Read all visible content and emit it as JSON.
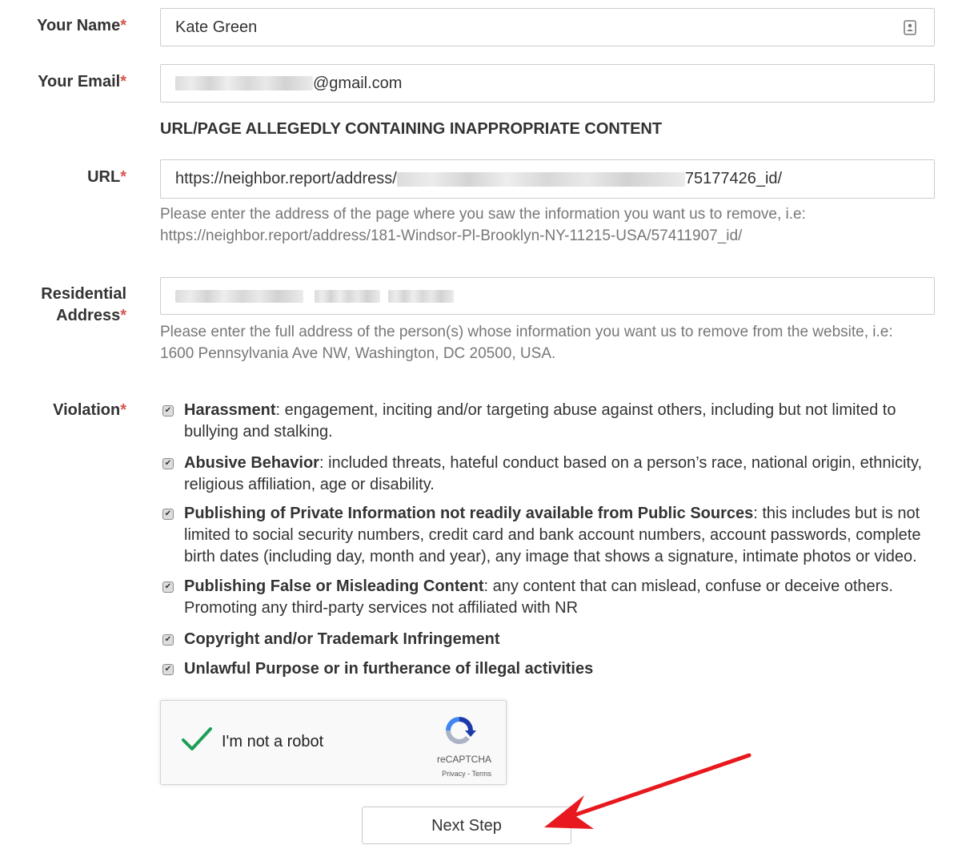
{
  "fields": {
    "name": {
      "label": "Your Name",
      "value": "Kate Green"
    },
    "email": {
      "label": "Your Email",
      "value_visible": "@gmail.com"
    },
    "url": {
      "label": "URL",
      "value_prefix": "https://neighbor.report/address/",
      "value_suffix": "75177426_id/",
      "help_line1": "Please enter the address of the page where you saw the information you want us to remove, i.e:",
      "help_line2": "https://neighbor.report/address/181-Windsor-Pl-Brooklyn-NY-11215-USA/57411907_id/"
    },
    "address": {
      "label_line1": "Residential",
      "label_line2": "Address",
      "help_line1": "Please enter the full address of the person(s) whose information you want us to remove from the website, i.e:",
      "help_line2": "1600 Pennsylvania Ave NW, Washington, DC 20500, USA."
    },
    "required_mark": "*"
  },
  "section_heading": "URL/PAGE ALLEGEDLY CONTAINING INAPPROPRIATE CONTENT",
  "violation": {
    "label": "Violation",
    "items": [
      {
        "title": "Harassment",
        "desc_line1": ": engagement, inciting and/or targeting abuse against others, including but not limited to",
        "desc_line2": "bullying and stalking.",
        "checked": true
      },
      {
        "title": "Abusive Behavior",
        "desc_line1": ": included threats, hateful conduct based on a person’s race, national origin, ethnicity,",
        "desc_line2": "religious affiliation, age or disability.",
        "checked": true
      },
      {
        "title": "Publishing of Private Information not readily available from Public Sources",
        "desc_line1": ": this includes but is not",
        "desc_line2": "limited to social security numbers, credit card and bank account numbers, account passwords, complete",
        "desc_line3": "birth dates (including day, month and year), any image that shows a signature, intimate photos or video.",
        "checked": true
      },
      {
        "title": "Publishing False or Misleading Content",
        "desc_line1": ": any content that can mislead, confuse or deceive others.",
        "desc_line2": "Promoting any third-party services not affiliated with NR",
        "checked": true
      },
      {
        "title": "Copyright and/or Trademark Infringement",
        "checked": true
      },
      {
        "title": "Unlawful Purpose or in furtherance of illegal activities",
        "checked": true
      }
    ]
  },
  "captcha": {
    "label": "I'm not a robot",
    "brand": "reCAPTCHA",
    "terms": "Privacy - Terms",
    "checked": true
  },
  "next_button": "Next Step",
  "icons": {
    "contact_card": "contact-card-icon",
    "check": "check-icon",
    "recaptcha_logo": "recaptcha-logo-icon",
    "arrow": "red-arrow-icon"
  },
  "colors": {
    "required": "#d9534f",
    "check_green": "#1e9e55",
    "arrow_red": "#e8191e",
    "help_text": "#777777"
  }
}
